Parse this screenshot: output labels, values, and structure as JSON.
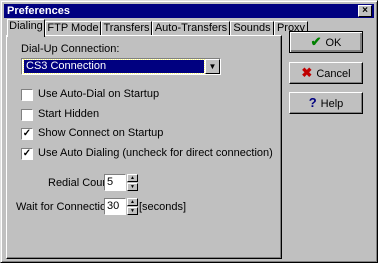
{
  "window": {
    "title": "Preferences",
    "close_glyph": "×"
  },
  "tabs": [
    {
      "label": "Dialing",
      "active": true
    },
    {
      "label": "FTP Mode",
      "active": false
    },
    {
      "label": "Transfers",
      "active": false
    },
    {
      "label": "Auto-Transfers",
      "active": false
    },
    {
      "label": "Sounds",
      "active": false
    },
    {
      "label": "Proxy",
      "active": false
    }
  ],
  "dialing": {
    "connection_label": "Dial-Up Connection:",
    "connection_value": "CS3 Connection",
    "options": [
      {
        "label": "Use Auto-Dial on Startup",
        "checked": false
      },
      {
        "label": "Start Hidden",
        "checked": false
      },
      {
        "label": "Show Connect on Startup",
        "checked": true
      },
      {
        "label": "Use Auto Dialing (uncheck for direct connection)",
        "checked": true
      }
    ],
    "redial_label": "Redial Count:",
    "redial_value": "5",
    "wait_label": "Wait for Connection :",
    "wait_value": "30",
    "wait_unit": "[seconds]"
  },
  "buttons": {
    "ok": {
      "label": "OK",
      "icon": "checkmark-icon",
      "color": "#008000"
    },
    "cancel": {
      "label": "Cancel",
      "icon": "x-mark-icon",
      "color": "#c00000"
    },
    "help": {
      "label": "Help",
      "icon": "question-mark-icon",
      "color": "#000080"
    }
  }
}
